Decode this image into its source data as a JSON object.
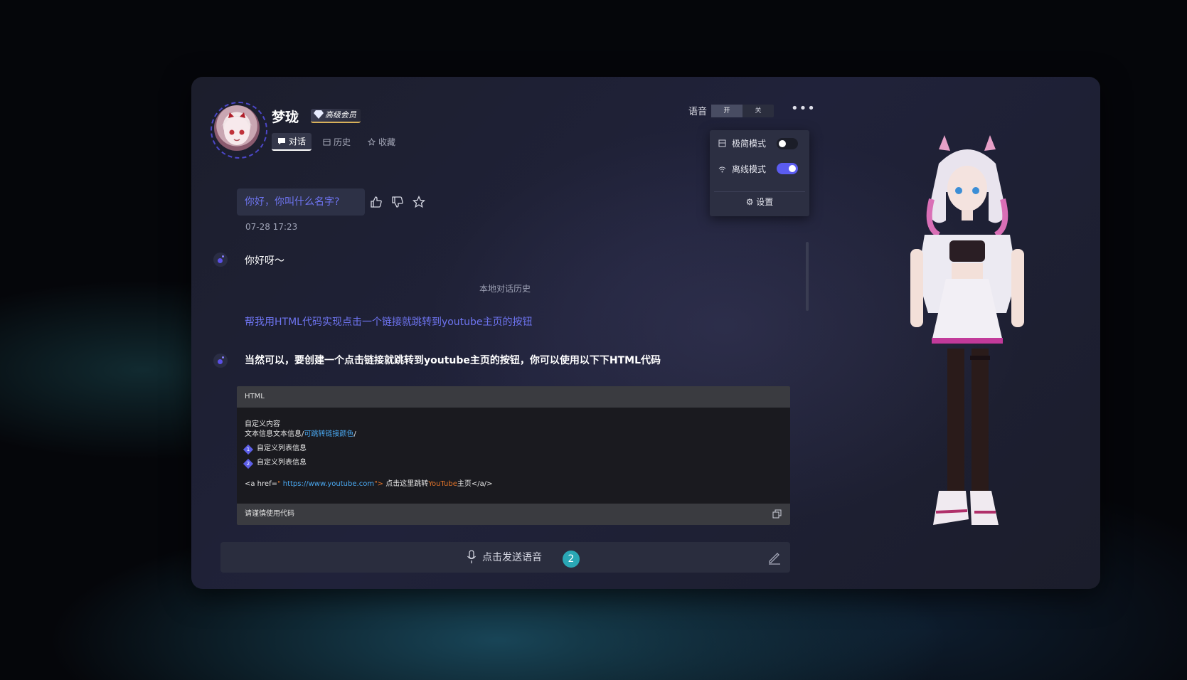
{
  "header": {
    "name": "梦珑",
    "vip_label": "高级会员",
    "tabs": [
      {
        "label": "对话",
        "icon": "chat-icon",
        "active": true
      },
      {
        "label": "历史",
        "icon": "calendar-icon",
        "active": false
      },
      {
        "label": "收藏",
        "icon": "star-icon",
        "active": false
      }
    ]
  },
  "voice": {
    "label": "语音",
    "on": "开",
    "off": "关",
    "selected": "开"
  },
  "menu": {
    "simple_mode": {
      "label": "极简模式",
      "enabled": false
    },
    "offline_mode": {
      "label": "离线模式",
      "enabled": true
    },
    "settings": "设置"
  },
  "chat": {
    "question": "你好，你叫什么名字?",
    "time": "07-28 17:23",
    "reply1": "你好呀～",
    "history_label": "本地对话历史",
    "user_request": "帮我用HTML代码实现点击一个链接就跳转到youtube主页的按钮",
    "reply2": "当然可以，要创建一个点击链接就跳转到youtube主页的按钮，你可以使用以下下HTML代码"
  },
  "code_block": {
    "lang": "HTML",
    "line1": "自定义内容",
    "line2_prefix": "文本信息文本信息/",
    "line2_link": "可跳转链接颜色",
    "line2_suffix": "/",
    "list": [
      {
        "num": "1",
        "text": "自定义列表信息"
      },
      {
        "num": "2",
        "text": "自定义列表信息"
      }
    ],
    "code_a_open": "<a href=",
    "code_quote1": "\" ",
    "code_url": "https://www.youtube.com",
    "code_quote2": "\">",
    "code_text1": " 点击这里跳转",
    "code_youtube": "YouTube",
    "code_text2": "主页</a/>",
    "footer": "请谨慎使用代码"
  },
  "input": {
    "voice_prompt": "点击发送语音",
    "counter": "2"
  },
  "colors": {
    "accent": "#5b5cf0",
    "link": "#6e74f0",
    "teal": "#2aa7b5",
    "orange": "#e0742a",
    "url_blue": "#4aa8f0"
  }
}
